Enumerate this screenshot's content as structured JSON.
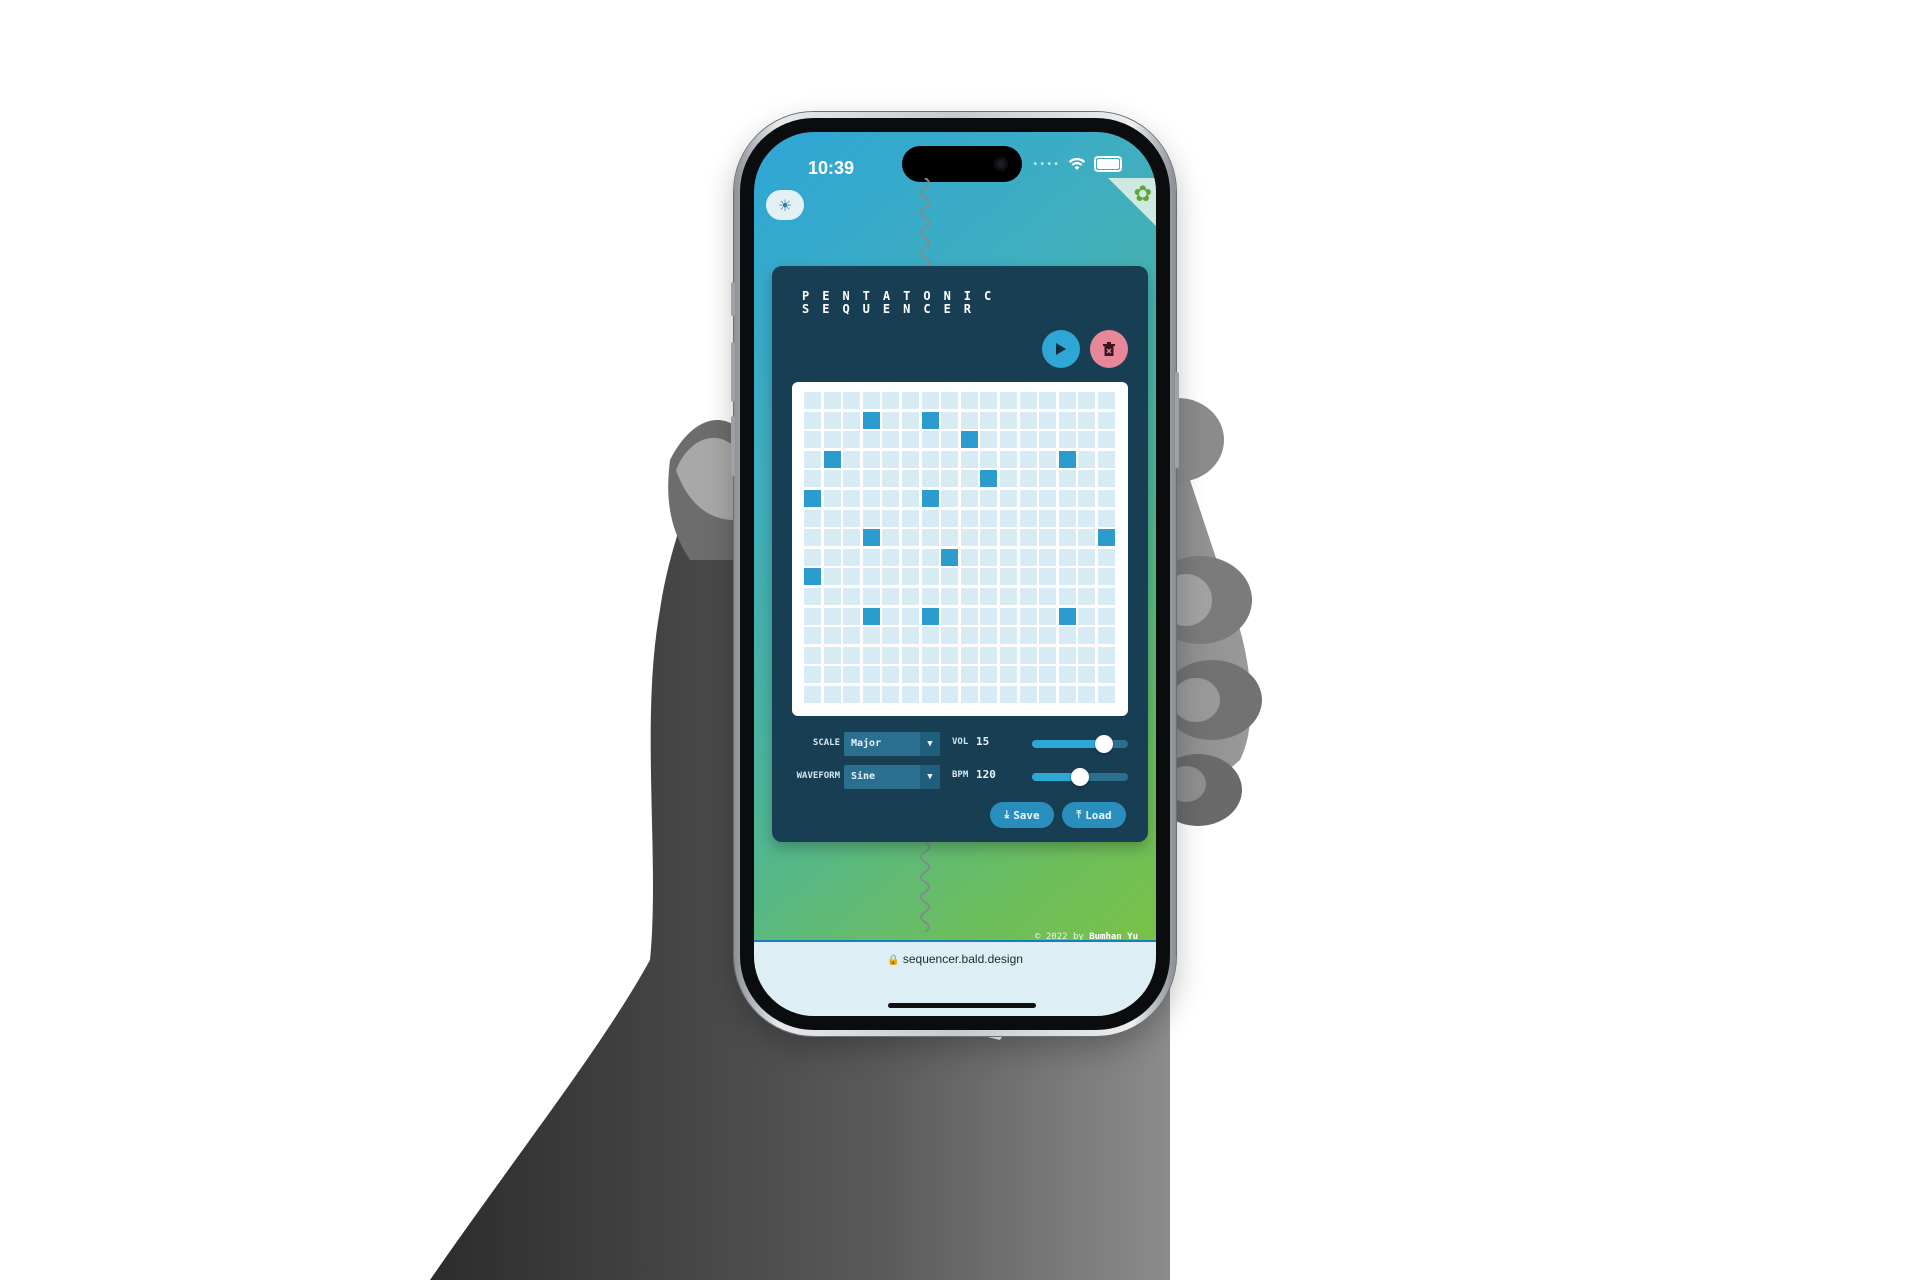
{
  "status_bar": {
    "time": "10:39",
    "signal_icon": "dots-icon",
    "wifi_icon": "wifi-icon",
    "battery_icon": "battery-icon"
  },
  "app": {
    "title_line1": "PENTATONIC",
    "title_line2": "SEQUENCER",
    "theme_toggle_icon": "sun-moon-icon",
    "corner_icon": "github-cat-icon",
    "play_icon": "play-icon",
    "clear_icon": "trash-icon"
  },
  "grid": {
    "columns": 16,
    "rows": 16,
    "active_cells": [
      [
        1,
        3
      ],
      [
        1,
        6
      ],
      [
        2,
        8
      ],
      [
        3,
        1
      ],
      [
        3,
        13
      ],
      [
        4,
        9
      ],
      [
        5,
        0
      ],
      [
        5,
        6
      ],
      [
        7,
        3
      ],
      [
        7,
        15
      ],
      [
        8,
        7
      ],
      [
        9,
        0
      ],
      [
        11,
        3
      ],
      [
        11,
        6
      ],
      [
        11,
        13
      ]
    ]
  },
  "controls": {
    "scale_label": "SCALE",
    "scale_value": "Major",
    "waveform_label": "WAVEFORM",
    "waveform_value": "Sine",
    "vol_label": "VOL",
    "vol_value": "15",
    "vol_level": 0.75,
    "bpm_label": "BPM",
    "bpm_value": "120",
    "bpm_level": 0.5,
    "save_label": "Save",
    "load_label": "Load"
  },
  "footer": {
    "prefix": "© 2022 by",
    "author": "Bumhan Yu"
  },
  "browser": {
    "url": "sequencer.bald.design"
  }
}
